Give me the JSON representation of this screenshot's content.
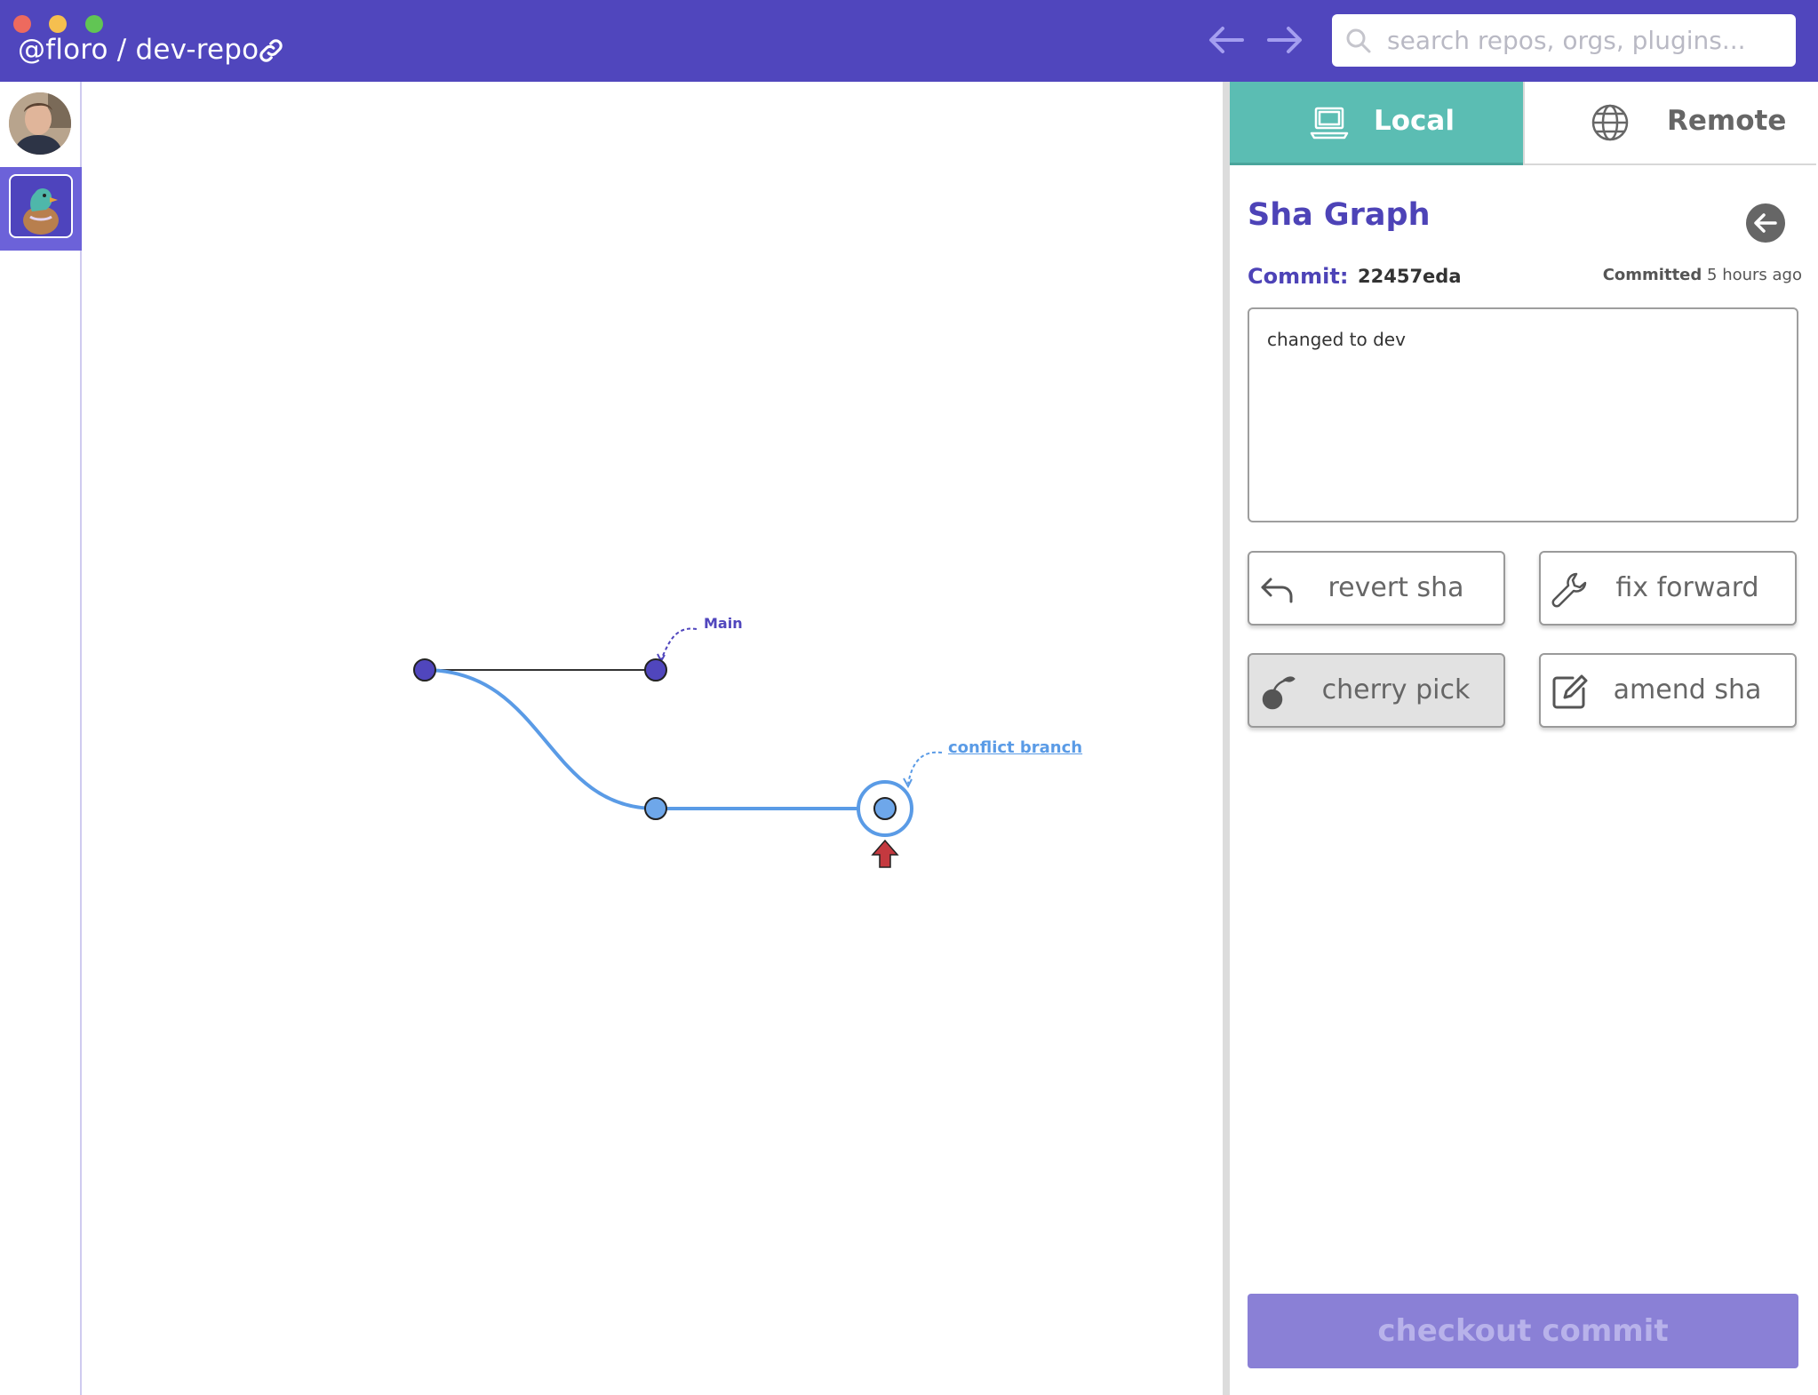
{
  "window": {
    "title": "@floro / dev-repo"
  },
  "search": {
    "placeholder": "search repos, orgs, plugins..."
  },
  "graph": {
    "branches": [
      {
        "name": "Main",
        "color": "#5046bd"
      },
      {
        "name": "conflict branch",
        "color": "#5a9be6"
      }
    ],
    "colors": {
      "main_node": "#5046bd",
      "branch_node": "#6ea7ea",
      "branch_line": "#5a9be6",
      "main_line": "#333333",
      "head_arrow": "#c4393f"
    }
  },
  "panel": {
    "tabs": [
      {
        "label": "Local",
        "active": true
      },
      {
        "label": "Remote",
        "active": false
      }
    ],
    "title": "Sha Graph",
    "commit_label": "Commit:",
    "commit_sha": "22457eda",
    "committed_label": "Committed",
    "committed_time": "5 hours ago",
    "message": "changed to dev",
    "actions": {
      "revert": "revert sha",
      "fix_forward": "fix forward",
      "cherry_pick": "cherry pick",
      "amend": "amend sha"
    },
    "checkout_label": "checkout commit"
  },
  "theme": {
    "header_bg": "#5046bd",
    "tab_active_bg": "#5bbdb3",
    "accent": "#4d43b7"
  }
}
